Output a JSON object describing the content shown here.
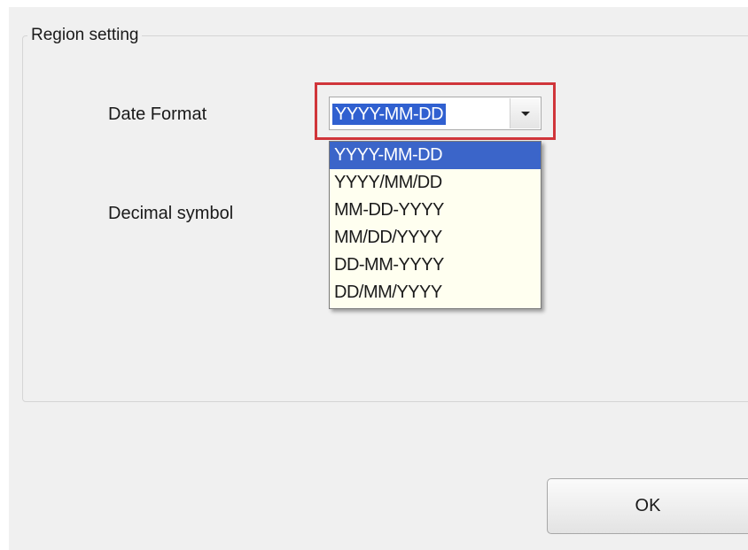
{
  "region_group": {
    "title": "Region setting"
  },
  "date_format": {
    "label": "Date Format",
    "selected_value": "YYYY-MM-DD",
    "dropdown_icon": "chevron-down-icon",
    "options": [
      "YYYY-MM-DD",
      "YYYY/MM/DD",
      "MM-DD-YYYY",
      "MM/DD/YYYY",
      "DD-MM-YYYY",
      "DD/MM/YYYY"
    ]
  },
  "decimal_symbol": {
    "label": "Decimal symbol"
  },
  "footer": {
    "ok_label": "OK"
  },
  "colors": {
    "highlight_border": "#d0353a",
    "selection": "#3b65c9",
    "dropdown_background": "#fffff0"
  }
}
